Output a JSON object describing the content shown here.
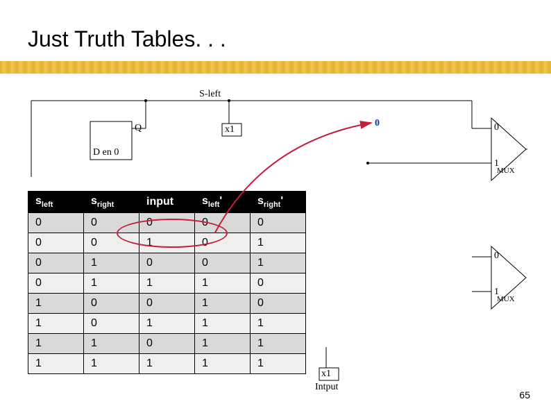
{
  "title": "Just Truth Tables. . .",
  "page_number": "65",
  "circuit": {
    "s_left": "S-left",
    "q": "Q",
    "d_en0": "D en 0",
    "x1_top": "x1",
    "zero_top": "0",
    "zero_mux_top": "0",
    "one_mux_top": "1",
    "mux_label_top": "MUX",
    "zero_mux_bot": "0",
    "one_mux_bot": "1",
    "mux_label_bot": "MUX",
    "x1_bot": "x1",
    "input_label": "Intput"
  },
  "truth_table": {
    "headers": {
      "sleft": "s",
      "sleft_sub": "left",
      "sright": "s",
      "sright_sub": "right",
      "input": "input",
      "sleft_p": "s",
      "sleft_p_sub": "left",
      "sleft_p_prime": "'",
      "sright_p": "s",
      "sright_p_sub": "right",
      "sright_p_prime": "'"
    },
    "rows": [
      [
        "0",
        "0",
        "0",
        "0",
        "0"
      ],
      [
        "0",
        "0",
        "1",
        "0",
        "1"
      ],
      [
        "0",
        "1",
        "0",
        "0",
        "1"
      ],
      [
        "0",
        "1",
        "1",
        "1",
        "0"
      ],
      [
        "1",
        "0",
        "0",
        "1",
        "0"
      ],
      [
        "1",
        "0",
        "1",
        "1",
        "1"
      ],
      [
        "1",
        "1",
        "0",
        "1",
        "1"
      ],
      [
        "1",
        "1",
        "1",
        "1",
        "1"
      ]
    ]
  },
  "chart_data": {
    "type": "table",
    "title": "Truth table for s_left' and s_right' as a function of s_left, s_right, input",
    "columns": [
      "s_left",
      "s_right",
      "input",
      "s_left'",
      "s_right'"
    ],
    "rows": [
      [
        0,
        0,
        0,
        0,
        0
      ],
      [
        0,
        0,
        1,
        0,
        1
      ],
      [
        0,
        1,
        0,
        0,
        1
      ],
      [
        0,
        1,
        1,
        1,
        0
      ],
      [
        1,
        0,
        0,
        1,
        0
      ],
      [
        1,
        0,
        1,
        1,
        1
      ],
      [
        1,
        1,
        0,
        1,
        1
      ],
      [
        1,
        1,
        1,
        1,
        1
      ]
    ],
    "annotation": {
      "circled_row_index": 1,
      "circled_columns": [
        "input"
      ],
      "arrow_to": "0 input of top MUX"
    }
  }
}
